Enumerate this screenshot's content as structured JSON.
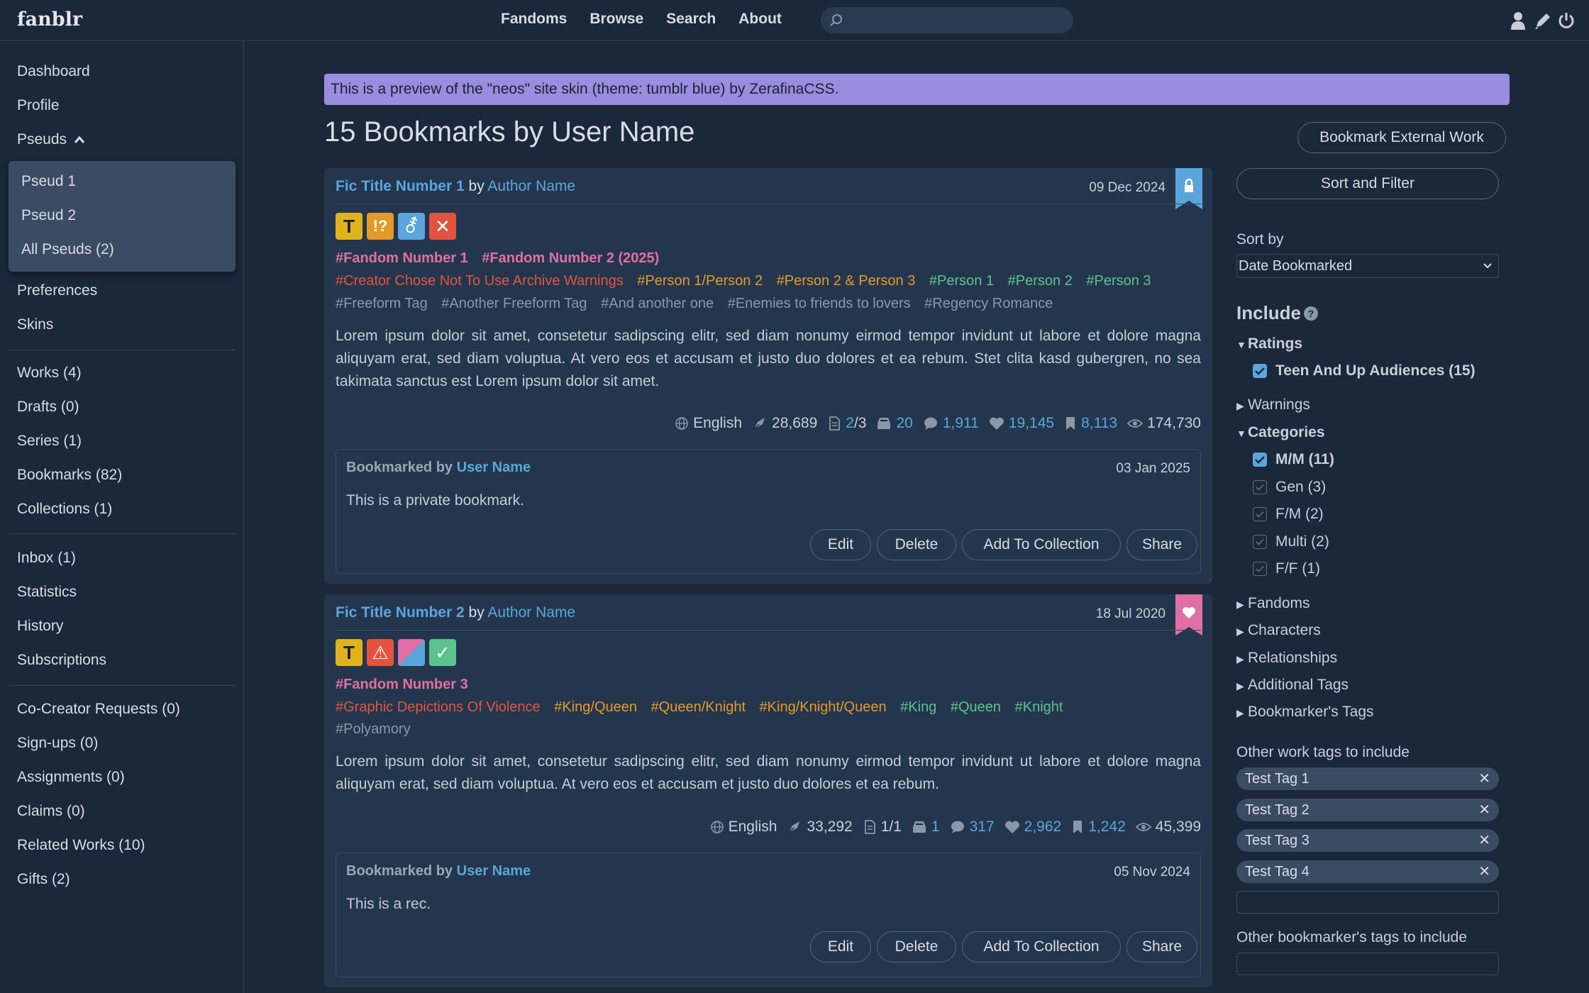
{
  "app": {
    "logo": "fanblr"
  },
  "nav": [
    "Fandoms",
    "Browse",
    "Search",
    "About"
  ],
  "search": {
    "placeholder": ""
  },
  "sidebar": {
    "dashboard": "Dashboard",
    "profile": "Profile",
    "pseuds": "Pseuds",
    "pseud_items": [
      "Pseud 1",
      "Pseud 2",
      "All Pseuds (2)"
    ],
    "preferences": "Preferences",
    "skins": "Skins",
    "works": "Works (4)",
    "drafts": "Drafts (0)",
    "series": "Series (1)",
    "bookmarks": "Bookmarks (82)",
    "collections": "Collections (1)",
    "inbox": "Inbox (1)",
    "statistics": "Statistics",
    "history": "History",
    "subscriptions": "Subscriptions",
    "cocreator": "Co-Creator Requests (0)",
    "signups": "Sign-ups (0)",
    "assignments": "Assignments (0)",
    "claims": "Claims (0)",
    "related": "Related Works (10)",
    "gifts": "Gifts (2)"
  },
  "banner": "This is a preview of the \"neos\" site skin (theme: tumblr blue) by ZerafinaCSS.",
  "page_title": "15 Bookmarks by User Name",
  "bookmark_external": "Bookmark External Work",
  "sort_filter": "Sort and Filter",
  "works": [
    {
      "title": "Fic Title Number 1",
      "by": "by",
      "author": "Author Name",
      "date": "09 Dec 2024",
      "fandoms": [
        "#Fandom Number 1",
        "#Fandom Number 2 (2025)"
      ],
      "warnings": [
        "#Creator Chose Not To Use Archive Warnings"
      ],
      "relationships": [
        "#Person 1/Person 2",
        "#Person 2 & Person 3"
      ],
      "characters": [
        "#Person 1",
        "#Person 2",
        "#Person 3"
      ],
      "freeforms": [
        "#Freeform Tag",
        "#Another Freeform Tag",
        "#And another one",
        "#Enemies to friends to lovers",
        "#Regency Romance"
      ],
      "summary": "Lorem ipsum dolor sit amet, consetetur sadipscing elitr, sed diam nonumy eirmod tempor invidunt ut labore et dolore magna aliquyam erat, sed diam voluptua. At vero eos et accusam et justo duo dolores et ea rebum. Stet clita kasd gubergren, no sea takimata sanctus est Lorem ipsum dolor sit amet.",
      "language": "English",
      "words": "28,689",
      "chapters_done": "2",
      "chapters_total": "/3",
      "collections": "20",
      "comments": "1,911",
      "kudos": "19,145",
      "bookmarks": "8,113",
      "hits": "174,730",
      "bm_label": "Bookmarked by",
      "bm_user": "User Name",
      "bm_date": "03 Jan 2025",
      "bm_note": "This is a private bookmark."
    },
    {
      "title": "Fic Title Number 2",
      "by": "by",
      "author": "Author Name",
      "date": "18 Jul 2020",
      "fandoms": [
        "#Fandom Number 3"
      ],
      "warnings": [
        "#Graphic Depictions Of Violence"
      ],
      "relationships": [
        "#King/Queen",
        "#Queen/Knight",
        "#King/Knight/Queen"
      ],
      "characters": [
        "#King",
        "#Queen",
        "#Knight"
      ],
      "freeforms": [
        "#Polyamory"
      ],
      "summary": "Lorem ipsum dolor sit amet, consetetur sadipscing elitr, sed diam nonumy eirmod tempor invidunt ut labore et dolore magna aliquyam erat, sed diam voluptua. At vero eos et accusam et justo duo dolores et ea rebum.",
      "language": "English",
      "words": "33,292",
      "chapters": "1/1",
      "collections": "1",
      "comments": "317",
      "kudos": "2,962",
      "bookmarks": "1,242",
      "hits": "45,399",
      "bm_label": "Bookmarked by",
      "bm_user": "User Name",
      "bm_date": "05 Nov 2024",
      "bm_note": "This is a rec."
    }
  ],
  "actions": [
    "Edit",
    "Delete",
    "Add To Collection",
    "Share"
  ],
  "square_glyphs_1": [
    "T",
    "!?",
    "⚦",
    "✕"
  ],
  "square_glyphs_2": [
    "T",
    "⚠",
    "",
    "✓"
  ],
  "filters": {
    "sort_by_label": "Sort by",
    "sort_by_value": "Date Bookmarked",
    "include": "Include",
    "help": "?",
    "ratings": "Ratings",
    "rating_teen": "Teen And Up Audiences (15)",
    "warnings": "Warnings",
    "categories": "Categories",
    "cat_mm": "M/M (11)",
    "cat_gen": "Gen (3)",
    "cat_fm": "F/M (2)",
    "cat_multi": "Multi (2)",
    "cat_ff": "F/F (1)",
    "fandoms": "Fandoms",
    "characters": "Characters",
    "relationships": "Relationships",
    "additional": "Additional Tags",
    "bookmarker_tags": "Bookmarker's Tags",
    "other_work_tags": "Other work tags to include",
    "chips": [
      "Test Tag 1",
      "Test Tag 2",
      "Test Tag 3",
      "Test Tag 4"
    ],
    "other_bookmarker_tags": "Other bookmarker's tags to include"
  },
  "colors": {
    "background": "#1b2839",
    "card": "#24364d",
    "link": "#5aa6dc",
    "banner": "#9a8ce0",
    "fandom": "#e06fa6",
    "warning": "#e2543f",
    "relationship": "#e39a2a",
    "character": "#5cc28f",
    "freeform": "#8a97a8"
  }
}
